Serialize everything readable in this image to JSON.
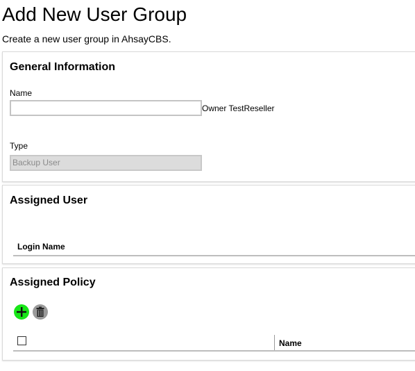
{
  "header": {
    "title": "Add New User Group",
    "subtitle": "Create a new user group in AhsayCBS."
  },
  "general": {
    "heading": "General Information",
    "name_label": "Name",
    "name_value": "",
    "owner_text": "Owner TestReseller",
    "type_label": "Type",
    "type_value": "Backup User"
  },
  "assigned_user": {
    "heading": "Assigned User",
    "columns": [
      "Login Name"
    ]
  },
  "assigned_policy": {
    "heading": "Assigned Policy",
    "add_icon": "plus-circle-icon",
    "delete_icon": "trash-icon",
    "columns": [
      "Name"
    ]
  },
  "colors": {
    "add_button": "#19e619",
    "delete_button": "#9a9a9a"
  }
}
